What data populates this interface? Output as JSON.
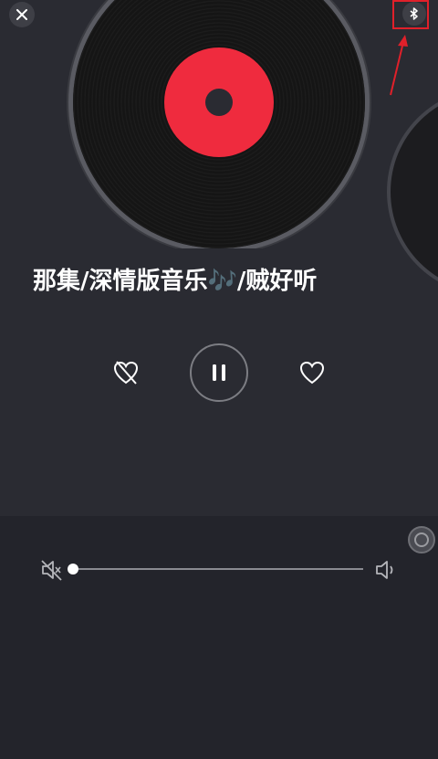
{
  "song": {
    "title": "那集/深情版音乐🎶/贼好听"
  },
  "player": {
    "state": "playing",
    "volume_fraction": 0.0
  },
  "icons": {
    "close": "close-icon",
    "bluetooth": "bluetooth-icon",
    "dislike": "broken-heart-icon",
    "pause": "pause-icon",
    "like": "heart-icon",
    "mute": "volume-mute-icon",
    "volume": "volume-icon"
  },
  "colors": {
    "accent_label": "#ef2b3e",
    "annotation": "#e0202a",
    "background": "#2a2b32"
  }
}
